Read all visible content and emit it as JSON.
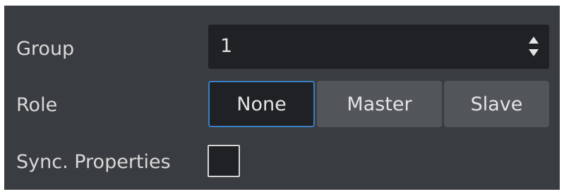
{
  "group": {
    "label": "Group",
    "value": "1",
    "increment_icon": "arrow-up-icon",
    "decrement_icon": "arrow-down-icon"
  },
  "role": {
    "label": "Role",
    "options": [
      "None",
      "Master",
      "Slave"
    ],
    "selected": "None"
  },
  "sync": {
    "label": "Sync. Properties",
    "checked": false
  },
  "colors": {
    "panel_bg": "#393c40",
    "field_bg": "#1f2125",
    "button_bg": "#52565b",
    "focus_accent": "#3b7fc4",
    "text": "#dcdcdc"
  }
}
